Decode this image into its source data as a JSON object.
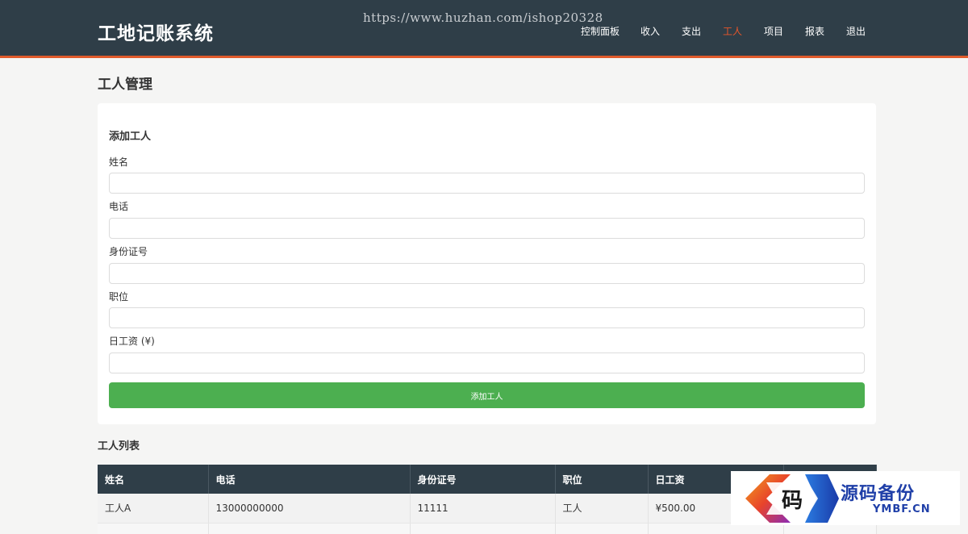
{
  "header": {
    "title": "工地记账系统",
    "watermark_url": "https://www.huzhan.com/ishop20328",
    "nav": [
      "控制面板",
      "收入",
      "支出",
      "工人",
      "项目",
      "报表",
      "退出"
    ],
    "active_nav": "工人"
  },
  "page": {
    "title": "工人管理"
  },
  "form": {
    "title": "添加工人",
    "fields": [
      {
        "label": "姓名",
        "value": ""
      },
      {
        "label": "电话",
        "value": ""
      },
      {
        "label": "身份证号",
        "value": ""
      },
      {
        "label": "职位",
        "value": ""
      },
      {
        "label": "日工资 (¥)",
        "value": ""
      }
    ],
    "submit_label": "添加工人"
  },
  "list": {
    "title": "工人列表",
    "columns": [
      "姓名",
      "电话",
      "身份证号",
      "职位",
      "日工资",
      ""
    ],
    "rows": [
      [
        "工人A",
        "13000000000",
        "11111",
        "工人",
        "¥500.00",
        ""
      ],
      [
        "",
        "",
        "",
        "",
        "",
        ""
      ]
    ]
  },
  "watermark_logo": {
    "glyph": "码",
    "cn_text": "源码备份",
    "en_text": "YMBF.CN"
  },
  "colors": {
    "header_bg": "#2f3e48",
    "accent": "#e05a2b",
    "active_nav": "#e8552a",
    "button": "#4caf50",
    "logo_blue": "#1f3fa8"
  }
}
